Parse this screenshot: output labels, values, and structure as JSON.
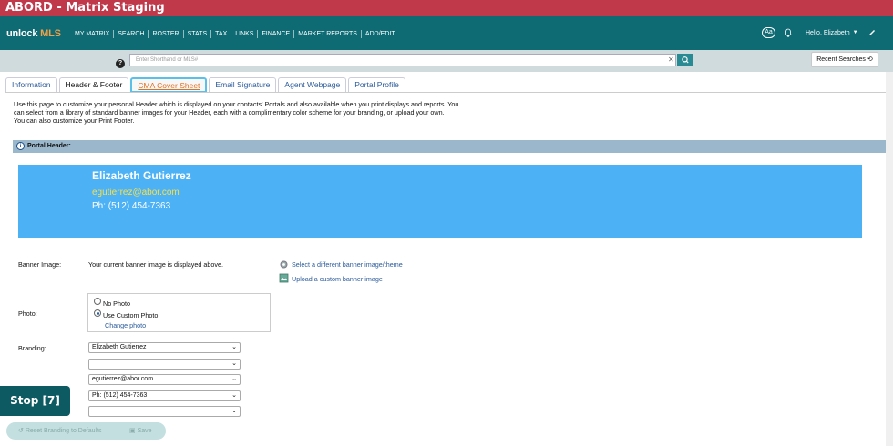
{
  "window": {
    "title": "ABORD - Matrix Staging"
  },
  "nav": {
    "logo_main": "unlock",
    "logo_accent": "MLS",
    "links": [
      "MY MATRIX",
      "SEARCH",
      "ROSTER",
      "STATS",
      "TAX",
      "LINKS",
      "FINANCE",
      "MARKET REPORTS",
      "ADD/EDIT"
    ],
    "font_toggle": "Aa",
    "greeting": "Hello, Elizabeth"
  },
  "search": {
    "placeholder": "Enter Shorthand or MLS#",
    "recent_label": "Recent Searches"
  },
  "tabs": [
    "Information",
    "Header & Footer",
    "CMA Cover Sheet",
    "Email Signature",
    "Agent Webpage",
    "Portal Profile"
  ],
  "intro": [
    "Use this page to customize your personal Header which is displayed on your contacts' Portals and also available when you print displays and reports. You",
    "can select from a library of standard banner images for your Header, each with a complimentary color scheme for your branding, or upload your own.",
    "You can also customize your Print Footer."
  ],
  "portal_header": {
    "section_title": "Portal Header:",
    "banner": {
      "name": "Elizabeth Gutierrez",
      "email": "egutierrez@abor.com",
      "phone": "Ph: (512) 454-7363",
      "background": "#4db1f5"
    },
    "banner_image_label": "Banner Image:",
    "banner_image_text": "Your current banner image is displayed above.",
    "select_banner_link": "Select a different banner image/theme",
    "upload_banner_link": "Upload a custom banner image",
    "photo_label": "Photo:",
    "photo_options": [
      "No Photo",
      "Use Custom Photo"
    ],
    "photo_selected": "Use Custom Photo",
    "change_photo_link": "Change photo",
    "branding_label": "Branding:",
    "branding_lines": [
      "Elizabeth Gutierrez",
      "",
      "egutierrez@abor.com",
      "Ph: (512) 454-7363",
      ""
    ]
  },
  "actions": {
    "stop": "Stop [7]",
    "reset": "Reset Branding to Defaults",
    "save": "Save"
  },
  "colors": {
    "title_bar": "#c0394b",
    "nav_bar": "#0e6a73",
    "accent": "#f0a24a"
  }
}
